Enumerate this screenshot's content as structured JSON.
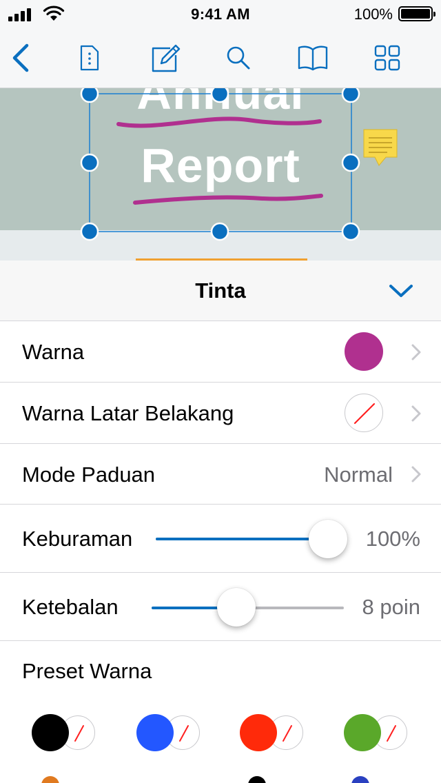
{
  "status_bar": {
    "time": "9:41 AM",
    "battery_percent": "100%",
    "signal_icon": "signal-bars-icon",
    "wifi_icon": "wifi-icon",
    "battery_icon": "battery-icon"
  },
  "toolbar": {
    "icons": [
      "back-chevron-icon",
      "document-icon",
      "annotate-pencil-icon",
      "search-icon",
      "book-icon",
      "grid-icon"
    ],
    "accent_color": "#0a6fbf"
  },
  "document": {
    "title_line1": "Annual",
    "title_line2": "Report",
    "banner_color": "#b5c5bf",
    "ink_color": "#b0308f",
    "note_icon": "sticky-note-icon"
  },
  "panel": {
    "title": "Tinta",
    "collapse_icon": "chevron-down-icon",
    "rows": {
      "color": {
        "label": "Warna",
        "swatch": "#b0308f"
      },
      "background": {
        "label": "Warna Latar Belakang",
        "swatch": "none"
      },
      "blend": {
        "label": "Mode Paduan",
        "value": "Normal"
      },
      "opacity": {
        "label": "Keburaman",
        "value": "100%",
        "level": 1.0
      },
      "thickness": {
        "label": "Ketebalan",
        "value": "8 poin",
        "level": 0.44
      }
    },
    "presets_label": "Preset Warna",
    "presets": [
      {
        "color": "#000000",
        "background": "none"
      },
      {
        "color": "#2357ff",
        "background": "none"
      },
      {
        "color": "#ff2a0a",
        "background": "none"
      },
      {
        "color": "#5aa82a",
        "background": "none"
      }
    ]
  }
}
